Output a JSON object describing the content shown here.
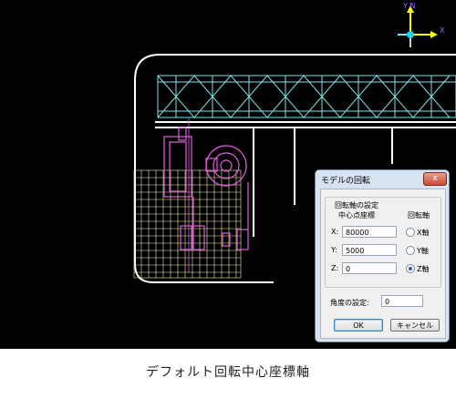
{
  "axis_indicator": {
    "y_label": "Y N",
    "x_label": "X"
  },
  "dialog": {
    "title": "モデルの回転",
    "close_label": "x",
    "group_title": "回転軸の設定",
    "center_header": "中心点座標",
    "axis_header": "回転軸",
    "fields": [
      {
        "label": "X:",
        "value": "80000"
      },
      {
        "label": "Y:",
        "value": "5000"
      },
      {
        "label": "Z:",
        "value": "0"
      }
    ],
    "axes": [
      {
        "label": "X軸",
        "selected": false
      },
      {
        "label": "Y軸",
        "selected": false
      },
      {
        "label": "Z軸",
        "selected": true
      }
    ],
    "angle_label": "角度の設定:",
    "angle_value": "0",
    "ok_label": "OK",
    "cancel_label": "キャンセル"
  },
  "caption": "デフォルト回転中心座標軸",
  "colors": {
    "background": "#000000",
    "truss": "#7fe3e6",
    "equipment": "#e05ce0",
    "grid": "#f2f2a0",
    "outline": "#ffffff"
  }
}
